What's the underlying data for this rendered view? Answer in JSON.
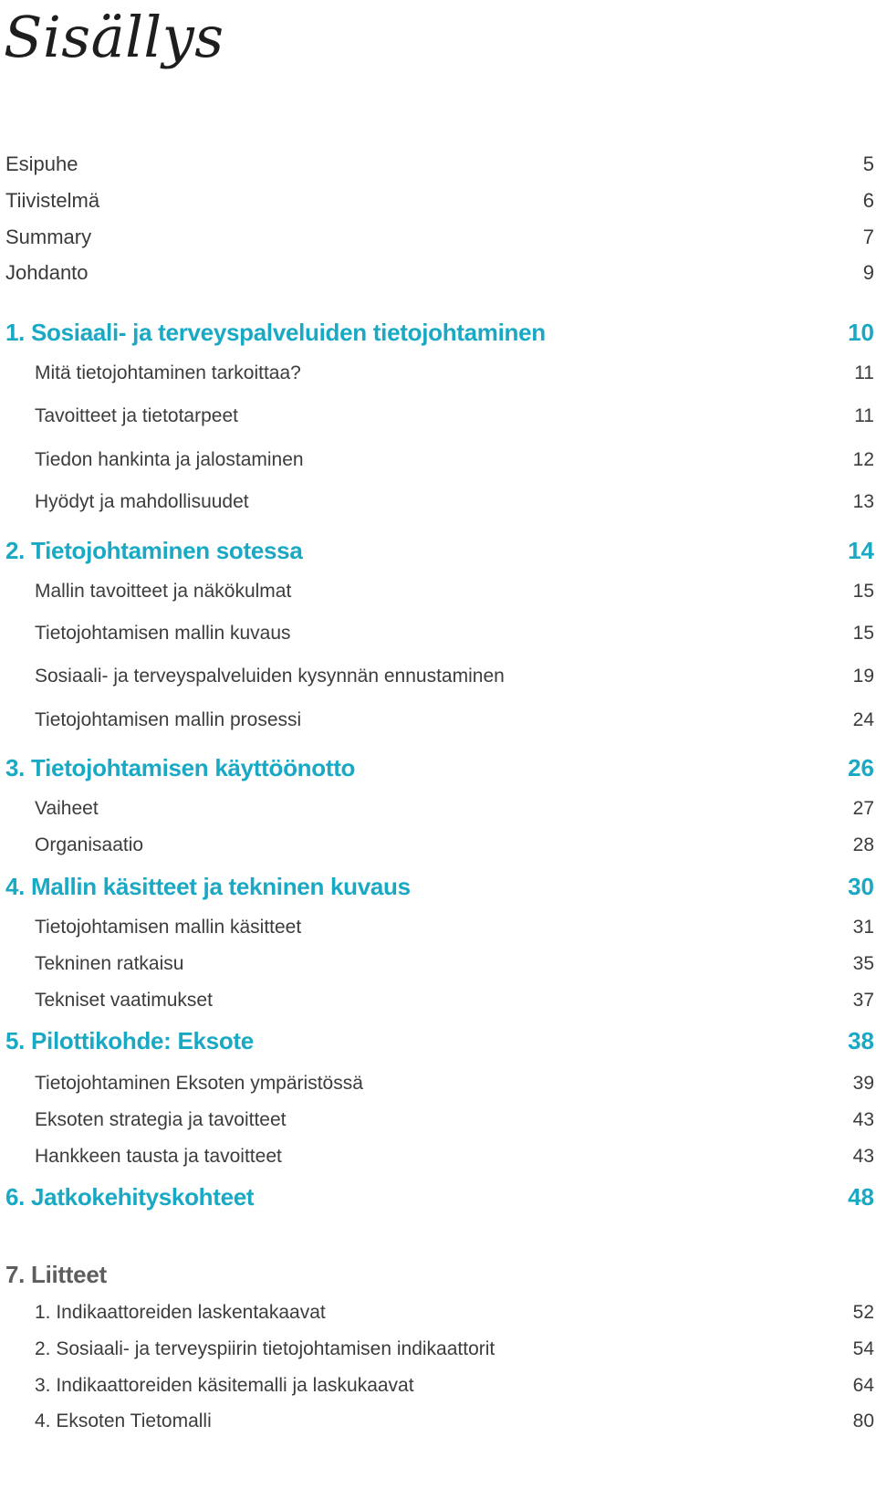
{
  "page_title": "Sisällys",
  "colors": {
    "accent": "#1aa9c4",
    "text": "#3c3c3c",
    "appendix_heading": "#5e5e5e"
  },
  "front_matter": [
    {
      "label": "Esipuhe",
      "page": "5"
    },
    {
      "label": "Tiivistelmä",
      "page": "6"
    },
    {
      "label": "Summary",
      "page": "7"
    },
    {
      "label": "Johdanto",
      "page": "9"
    }
  ],
  "sections": [
    {
      "label": "1. Sosiaali- ja terveyspalveluiden tietojohtaminen",
      "page": "10",
      "items": [
        {
          "label": "Mitä tietojohtaminen tarkoittaa?",
          "page": "11"
        },
        {
          "label": "Tavoitteet ja tietotarpeet",
          "page": "11"
        },
        {
          "label": "Tiedon hankinta ja jalostaminen",
          "page": "12"
        },
        {
          "label": "Hyödyt ja mahdollisuudet",
          "page": "13"
        }
      ]
    },
    {
      "label": "2. Tietojohtaminen sotessa",
      "page": "14",
      "items": [
        {
          "label": "Mallin tavoitteet ja näkökulmat",
          "page": "15"
        },
        {
          "label": "Tietojohtamisen mallin kuvaus",
          "page": "15"
        },
        {
          "label": "Sosiaali- ja terveyspalveluiden kysynnän ennustaminen",
          "page": "19"
        },
        {
          "label": "Tietojohtamisen mallin prosessi",
          "page": "24"
        }
      ]
    },
    {
      "label": "3. Tietojohtamisen käyttöönotto",
      "page": "26",
      "items": [
        {
          "label": "Vaiheet",
          "page": "27"
        },
        {
          "label": "Organisaatio",
          "page": "28"
        }
      ]
    },
    {
      "label": "4. Mallin käsitteet ja tekninen kuvaus",
      "page": "30",
      "items": [
        {
          "label": "Tietojohtamisen mallin käsitteet",
          "page": "31"
        },
        {
          "label": "Tekninen ratkaisu",
          "page": "35"
        },
        {
          "label": "Tekniset vaatimukset",
          "page": "37"
        }
      ]
    },
    {
      "label": "5. Pilottikohde: Eksote",
      "page": "38",
      "items": [
        {
          "label": "Tietojohtaminen Eksoten ympäristössä",
          "page": "39"
        },
        {
          "label": "Eksoten strategia ja tavoitteet",
          "page": "43"
        },
        {
          "label": "Hankkeen tausta ja tavoitteet",
          "page": "43"
        }
      ]
    },
    {
      "label": "6. Jatkokehityskohteet",
      "page": "48",
      "items": []
    },
    {
      "label": "7. Liitteet",
      "page": "",
      "items": [
        {
          "label": "1. Indikaattoreiden laskentakaavat",
          "page": "52"
        },
        {
          "label": "2. Sosiaali- ja terveyspiirin tietojohtamisen indikaattorit",
          "page": "54"
        },
        {
          "label": "3. Indikaattoreiden käsitemalli ja laskukaavat",
          "page": "64"
        },
        {
          "label": "4. Eksoten Tietomalli",
          "page": "80"
        }
      ]
    }
  ]
}
